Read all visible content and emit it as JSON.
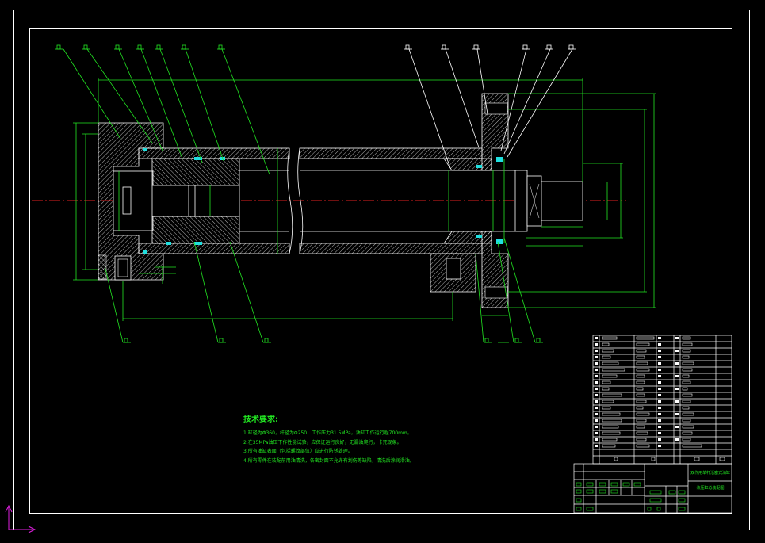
{
  "technical_requirements": {
    "title": "技术要求:",
    "items": [
      "1.缸径为Φ360，杆径为Φ250，工作压力31.5MPa，油缸工作运行程700mm。",
      "2.在35MPa油压下作性能试验，应保证运行良好，无漏油爬行，卡死现象。",
      "3.所有油缸表面（包括螺纹部位）应进行防锈处理。",
      "4.所有零件在装配前用油清洗，各密封面不允许有划伤等缺陷，清洗后涂润滑油。"
    ]
  },
  "title_block": {
    "drawing_name": "双作用单杆活塞式油缸",
    "part_label": "液压缸总装配图"
  },
  "colors": {
    "background": "#000000",
    "frame": "#ffffff",
    "geometry": "#22e622",
    "centerline": "#e02020",
    "hatch": "#ffffff",
    "ucs": "#e020e0"
  }
}
